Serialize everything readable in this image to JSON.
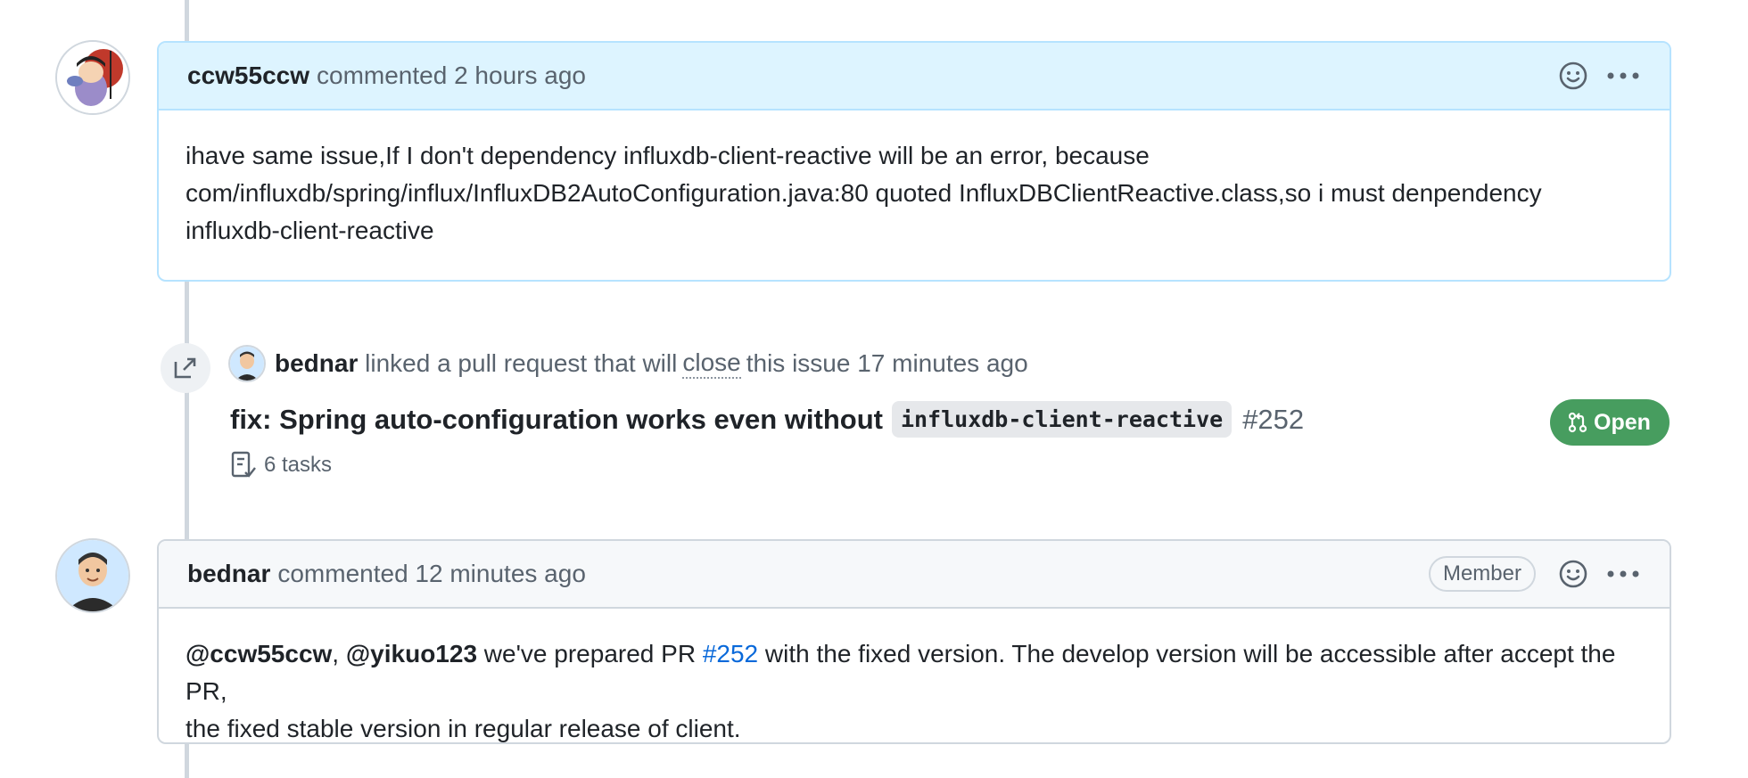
{
  "comments": [
    {
      "author": "ccw55ccw",
      "meta": "commented 2 hours ago",
      "body": {
        "line1": "ihave same issue,If I don't dependency influxdb-client-reactive will be an error, because",
        "line2": "com/influxdb/spring/influx/InfluxDB2AutoConfiguration.java:80 quoted InfluxDBClientReactive.class,so i must denpendency",
        "line3": "influxdb-client-reactive"
      }
    },
    {
      "author": "bednar",
      "meta": "commented 12 minutes ago",
      "role": "Member",
      "body": {
        "mention1": "@ccw55ccw",
        "sep": ", ",
        "mention2": "@yikuo123",
        "text1": " we've prepared PR ",
        "pr_link": "#252",
        "text2": " with the fixed version. The develop version will be accessible after accept the PR,",
        "line2": "the fixed stable version in regular release of client."
      }
    }
  ],
  "event": {
    "actor": "bednar",
    "text_before": "linked a pull request that will",
    "close_word": "close",
    "text_after": "this issue 17 minutes ago"
  },
  "pull_request": {
    "title": "fix: Spring auto-configuration works even without",
    "code": "influxdb-client-reactive",
    "number": "#252",
    "tasks": "6 tasks",
    "status": "Open"
  },
  "colors": {
    "highlight_header": "#ddf4ff",
    "open_badge": "#1f883d",
    "link": "#0969da"
  },
  "icons": [
    "smiley-icon",
    "kebab-horizontal-icon",
    "cross-reference-icon",
    "tasklist-icon",
    "git-pull-request-icon"
  ]
}
